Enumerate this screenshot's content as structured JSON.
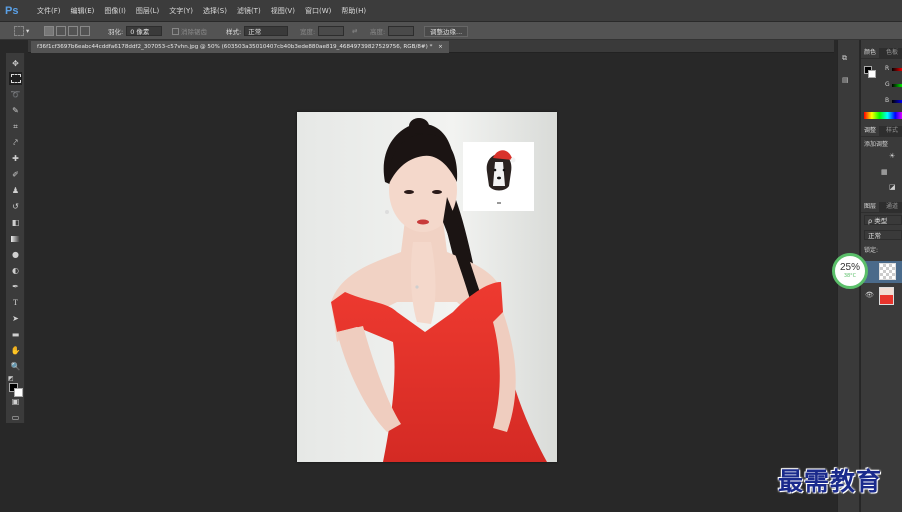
{
  "app": {
    "logo": "Ps"
  },
  "menu": [
    "文件(F)",
    "编辑(E)",
    "图像(I)",
    "图层(L)",
    "文字(Y)",
    "选择(S)",
    "滤镜(T)",
    "视图(V)",
    "窗口(W)",
    "帮助(H)"
  ],
  "options": {
    "feather_label": "羽化:",
    "feather_value": "0 像素",
    "antialias_label": "消除锯齿",
    "style_label": "样式:",
    "style_value": "正常",
    "width_label": "宽度:",
    "height_label": "高度:",
    "refine_edge": "调整边缘..."
  },
  "document": {
    "tab_title": "f36f1cf3697b6eabc44cddfa6178ddf2_307053-c57vhn.jpg @ 50% (603503a35010407cb40b3ede880ae819_46849739827529756, RGB/8#) *",
    "close": "×"
  },
  "panels": {
    "color_tab": "颜色",
    "swatches_tab": "色板",
    "channels": [
      "R",
      "G",
      "B"
    ],
    "adjust_tab": "调整",
    "styles_tab": "样式",
    "add_adjust": "添加调整",
    "layers_tab": "图层",
    "paths_tab": "通道",
    "kind_label": "ρ 类型",
    "blend_mode": "正常",
    "lock_label": "锁定:"
  },
  "badge": {
    "percent": "25%",
    "temp": "38°C"
  },
  "watermark": "最需教育",
  "colors": {
    "accent": "#5aa0e6",
    "badge_ring": "#5bbf6a",
    "dress_red": "#e8342c",
    "watermark": "#1a2a8c"
  }
}
